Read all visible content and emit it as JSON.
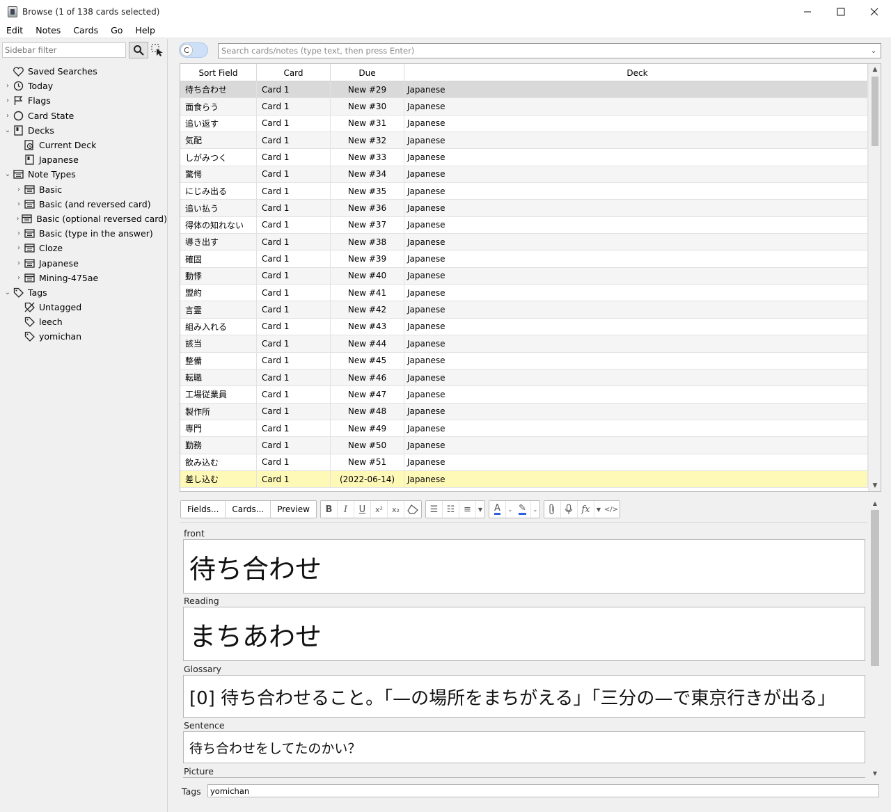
{
  "window": {
    "title": "Browse (1 of 138 cards selected)",
    "controls": [
      "—",
      "☐",
      "✕"
    ]
  },
  "menu": [
    "Edit",
    "Notes",
    "Cards",
    "Go",
    "Help"
  ],
  "sidebar": {
    "filter_placeholder": "Sidebar filter",
    "items": [
      {
        "label": "Saved Searches",
        "icon": "heart-icon",
        "level": 0,
        "arrow": ""
      },
      {
        "label": "Today",
        "icon": "clock-icon",
        "level": 0,
        "arrow": "›"
      },
      {
        "label": "Flags",
        "icon": "flag-icon",
        "level": 0,
        "arrow": "›"
      },
      {
        "label": "Card State",
        "icon": "circle-icon",
        "level": 0,
        "arrow": "›"
      },
      {
        "label": "Decks",
        "icon": "deck-icon",
        "level": 0,
        "arrow": "⌄"
      },
      {
        "label": "Current Deck",
        "icon": "current-deck-icon",
        "level": 1,
        "arrow": ""
      },
      {
        "label": "Japanese",
        "icon": "deck-icon",
        "level": 1,
        "arrow": ""
      },
      {
        "label": "Note Types",
        "icon": "note-type-icon",
        "level": 0,
        "arrow": "⌄"
      },
      {
        "label": "Basic",
        "icon": "note-type-icon",
        "level": 1,
        "arrow": "›"
      },
      {
        "label": "Basic (and reversed card)",
        "icon": "note-type-icon",
        "level": 1,
        "arrow": "›"
      },
      {
        "label": "Basic (optional reversed card)",
        "icon": "note-type-icon",
        "level": 1,
        "arrow": "›"
      },
      {
        "label": "Basic (type in the answer)",
        "icon": "note-type-icon",
        "level": 1,
        "arrow": "›"
      },
      {
        "label": "Cloze",
        "icon": "note-type-icon",
        "level": 1,
        "arrow": "›"
      },
      {
        "label": "Japanese",
        "icon": "note-type-icon",
        "level": 1,
        "arrow": "›"
      },
      {
        "label": "Mining-475ae",
        "icon": "note-type-icon",
        "level": 1,
        "arrow": "›"
      },
      {
        "label": "Tags",
        "icon": "tag-icon",
        "level": 0,
        "arrow": "⌄"
      },
      {
        "label": "Untagged",
        "icon": "untagged-icon",
        "level": 1,
        "arrow": ""
      },
      {
        "label": "leech",
        "icon": "tag-icon",
        "level": 1,
        "arrow": ""
      },
      {
        "label": "yomichan",
        "icon": "tag-icon",
        "level": 1,
        "arrow": ""
      }
    ]
  },
  "search": {
    "toggle_label": "C",
    "placeholder": "Search cards/notes (type text, then press Enter)"
  },
  "table": {
    "columns": [
      "Sort Field",
      "Card",
      "Due",
      "Deck"
    ],
    "sort_indicator": "^",
    "rows": [
      {
        "sort": "待ち合わせ",
        "card": "Card 1",
        "due": "New #29",
        "deck": "Japanese",
        "state": "selected"
      },
      {
        "sort": "面食らう",
        "card": "Card 1",
        "due": "New #30",
        "deck": "Japanese"
      },
      {
        "sort": "追い返す",
        "card": "Card 1",
        "due": "New #31",
        "deck": "Japanese"
      },
      {
        "sort": "気配",
        "card": "Card 1",
        "due": "New #32",
        "deck": "Japanese"
      },
      {
        "sort": "しがみつく",
        "card": "Card 1",
        "due": "New #33",
        "deck": "Japanese"
      },
      {
        "sort": "驚愕",
        "card": "Card 1",
        "due": "New #34",
        "deck": "Japanese"
      },
      {
        "sort": "にじみ出る",
        "card": "Card 1",
        "due": "New #35",
        "deck": "Japanese"
      },
      {
        "sort": "追い払う",
        "card": "Card 1",
        "due": "New #36",
        "deck": "Japanese"
      },
      {
        "sort": "得体の知れない",
        "card": "Card 1",
        "due": "New #37",
        "deck": "Japanese"
      },
      {
        "sort": "導き出す",
        "card": "Card 1",
        "due": "New #38",
        "deck": "Japanese"
      },
      {
        "sort": "確固",
        "card": "Card 1",
        "due": "New #39",
        "deck": "Japanese"
      },
      {
        "sort": "動悸",
        "card": "Card 1",
        "due": "New #40",
        "deck": "Japanese"
      },
      {
        "sort": "盟約",
        "card": "Card 1",
        "due": "New #41",
        "deck": "Japanese"
      },
      {
        "sort": "言霊",
        "card": "Card 1",
        "due": "New #42",
        "deck": "Japanese"
      },
      {
        "sort": "組み入れる",
        "card": "Card 1",
        "due": "New #43",
        "deck": "Japanese"
      },
      {
        "sort": "該当",
        "card": "Card 1",
        "due": "New #44",
        "deck": "Japanese"
      },
      {
        "sort": "整備",
        "card": "Card 1",
        "due": "New #45",
        "deck": "Japanese"
      },
      {
        "sort": "転職",
        "card": "Card 1",
        "due": "New #46",
        "deck": "Japanese"
      },
      {
        "sort": "工場従業員",
        "card": "Card 1",
        "due": "New #47",
        "deck": "Japanese"
      },
      {
        "sort": "製作所",
        "card": "Card 1",
        "due": "New #48",
        "deck": "Japanese"
      },
      {
        "sort": "専門",
        "card": "Card 1",
        "due": "New #49",
        "deck": "Japanese"
      },
      {
        "sort": "勤務",
        "card": "Card 1",
        "due": "New #50",
        "deck": "Japanese"
      },
      {
        "sort": "飲み込む",
        "card": "Card 1",
        "due": "New #51",
        "deck": "Japanese"
      },
      {
        "sort": "差し込む",
        "card": "Card 1",
        "due": "(2022-06-14)",
        "deck": "Japanese",
        "state": "flagged"
      }
    ]
  },
  "editor": {
    "buttons": [
      "Fields...",
      "Cards...",
      "Preview"
    ],
    "format_icons": {
      "bold": "B",
      "italic": "I",
      "underline": "U",
      "superscript": "x²",
      "subscript": "x₂",
      "eraser": "⌫",
      "bullet_list": "☰",
      "numbered_list": "☷",
      "align": "≡",
      "text_color": "A",
      "highlight": "✎",
      "attach": "⊘",
      "record": "◉",
      "math": "fx",
      "html": "</>"
    },
    "fields": [
      {
        "label": "front",
        "value": "待ち合わせ"
      },
      {
        "label": "Reading",
        "value": "まちあわせ"
      },
      {
        "label": "Glossary",
        "value": "[0] 待ち合わせること。「—の場所をまちがえる」「三分の—で東京行きが出る」"
      },
      {
        "label": "Sentence",
        "value": "待ち合わせをしてたのかい？"
      },
      {
        "label": "Picture",
        "value": ""
      }
    ],
    "tags_label": "Tags",
    "tags_value": "yomichan"
  },
  "colors": {
    "selected_row": "#d9d9d9",
    "flagged_row": "#fff9b8",
    "toggle_bg": "#cde0f8",
    "text_color_underline": "#2e5fe0"
  }
}
